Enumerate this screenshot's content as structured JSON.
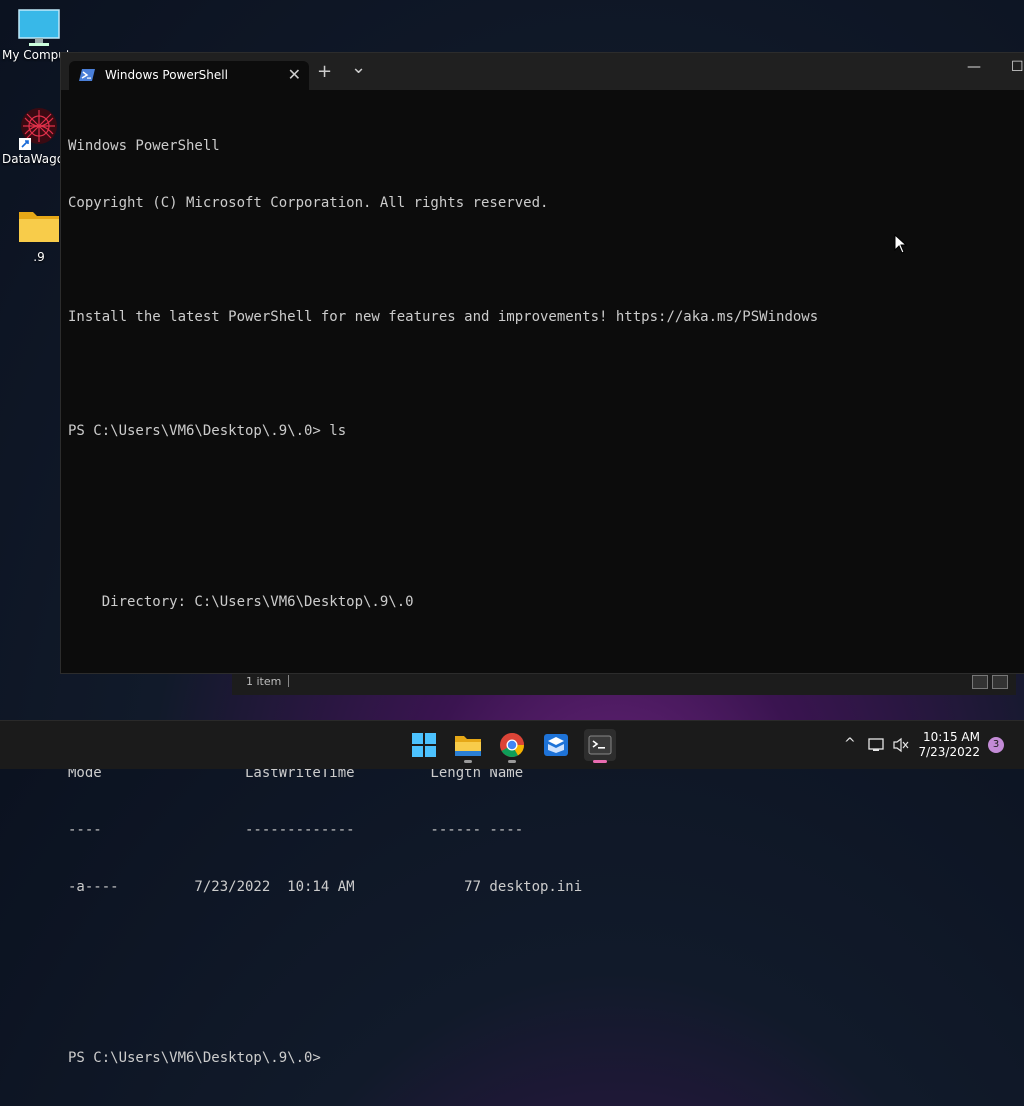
{
  "desktop": {
    "icons": [
      {
        "label": "My Computer",
        "icon": "monitor-icon"
      },
      {
        "label": "DataWagon",
        "icon": "datawagon-icon"
      },
      {
        "label": ".9",
        "icon": "folder-icon"
      }
    ]
  },
  "explorer": {
    "status": "1 item"
  },
  "terminal": {
    "tab_title": "Windows PowerShell",
    "new_tab": "+",
    "dropdown": "⌄",
    "close_tab": "✕",
    "minimize": "—",
    "maximize": "☐",
    "lines": [
      "Windows PowerShell",
      "Copyright (C) Microsoft Corporation. All rights reserved.",
      "",
      "Install the latest PowerShell for new features and improvements! https://aka.ms/PSWindows",
      "",
      "PS C:\\Users\\VM6\\Desktop\\.9\\.0> ls",
      "",
      "",
      "    Directory: C:\\Users\\VM6\\Desktop\\.9\\.0",
      "",
      "",
      "Mode                 LastWriteTime         Length Name",
      "----                 -------------         ------ ----",
      "-a----         7/23/2022  10:14 AM             77 desktop.ini",
      "",
      "",
      "PS C:\\Users\\VM6\\Desktop\\.9\\.0>"
    ]
  },
  "taskbar": {
    "apps": [
      {
        "name": "start",
        "icon": "windows-start-icon"
      },
      {
        "name": "file-explorer",
        "icon": "folder-icon"
      },
      {
        "name": "chrome",
        "icon": "chrome-icon"
      },
      {
        "name": "mail-app",
        "icon": "mail-box-icon"
      },
      {
        "name": "terminal",
        "icon": "terminal-icon"
      }
    ],
    "tray": {
      "chevron": "^",
      "network": "network-icon",
      "volume": "volume-muted-icon"
    },
    "time": "10:15 AM",
    "date": "7/23/2022",
    "notifications": "3"
  },
  "colors": {
    "console_bg": "#0c0c0c",
    "console_text": "#cccccc",
    "accent": "#e86bb0"
  }
}
